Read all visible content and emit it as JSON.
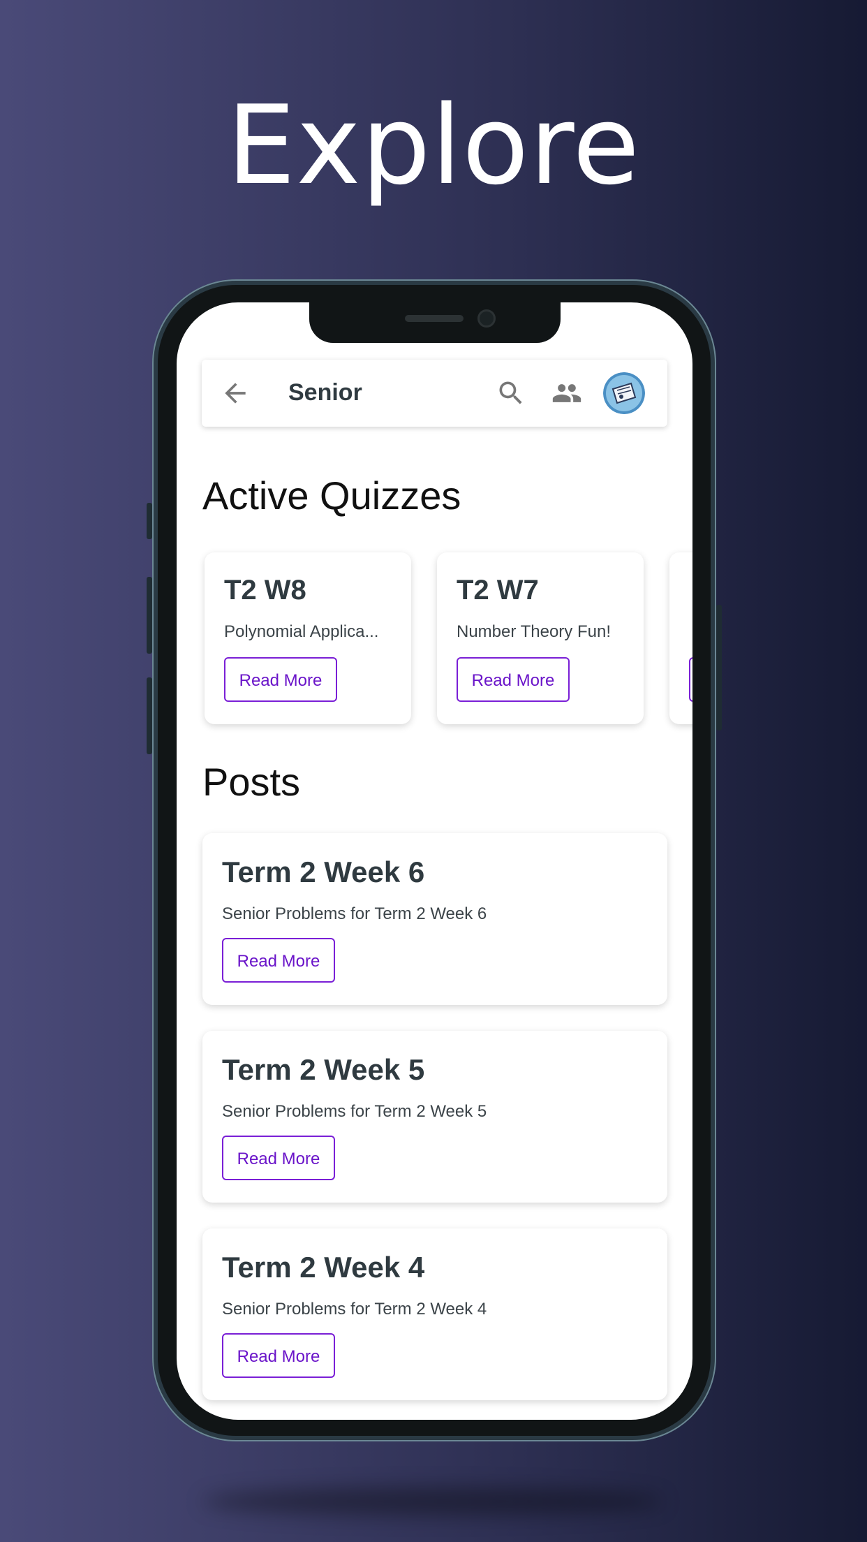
{
  "headline": "Explore",
  "app": {
    "title": "Senior",
    "back_icon": "arrow-left-icon",
    "search_icon": "search-icon",
    "people_icon": "people-icon",
    "avatar": "user-avatar"
  },
  "sections": {
    "quizzes_title": "Active Quizzes",
    "posts_title": "Posts"
  },
  "quizzes": [
    {
      "title": "T2 W8",
      "desc": "Polynomial Applica...",
      "button": "Read More"
    },
    {
      "title": "T2 W7",
      "desc": "Number Theory Fun!",
      "button": "Read More"
    }
  ],
  "posts": [
    {
      "title": "Term 2 Week 6",
      "desc": "Senior Problems for Term 2 Week 6",
      "button": "Read More"
    },
    {
      "title": "Term 2 Week 5",
      "desc": "Senior Problems for Term 2 Week 5",
      "button": "Read More"
    },
    {
      "title": "Term 2 Week 4",
      "desc": "Senior Problems for Term 2 Week 4",
      "button": "Read More"
    }
  ],
  "colors": {
    "accent": "#7a1fd6",
    "text_dark": "#2f3a40",
    "background_left": "#4a4a78",
    "background_right": "#161a33"
  }
}
